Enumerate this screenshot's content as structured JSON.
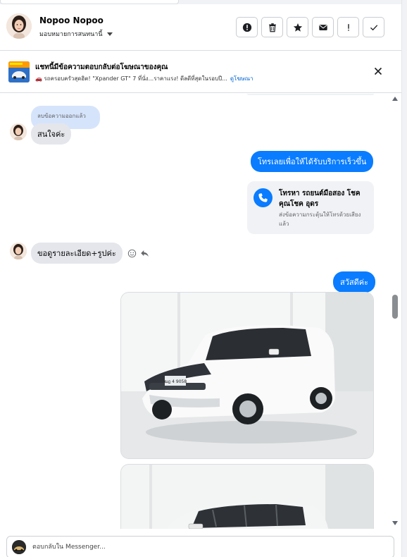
{
  "header": {
    "name": "Nopoo Nopoo",
    "assign_label": "มอบหมายการสนทนานี้",
    "actions": [
      "mark-spam-icon",
      "delete-icon",
      "star-icon",
      "mark-unread-icon",
      "follow-up-icon",
      "done-icon"
    ]
  },
  "banner": {
    "title": "แชทนี้มีข้อความตอบกลับต่อโฆษณาของคุณ",
    "subtitle": "🚗 รถครอบครัวสุดฮิต! \"Xpander GT\" 7 ที่นั่ง...ราคาแรง! ดีลดีที่สุดในรอบปี...",
    "link": "ดูโฆษณา"
  },
  "messages": {
    "unsent_label": "ลบข้อความออกแล้ว",
    "incoming_1": "สนใจค่ะ",
    "outgoing_1": "โทรเลยเพื่อให้ได้รับบริการเร็วขึ้น",
    "call_card": {
      "title": "โทรหา รถยนต์มือสอง โชคคุณโชค อุดร",
      "subtitle": "ส่งข้อความกระตุ้นให้โทรด้วยเสียงแล้ว"
    },
    "incoming_2": "ขอดูรายละเอียด+รูปค่ะ",
    "outgoing_2": "สวัสดีค่ะ",
    "plate_text": "ฒฎ 4 9058"
  },
  "composer": {
    "placeholder": "ตอบกลับใน Messenger..."
  },
  "colors": {
    "accent": "#0a7cff",
    "incoming_bubble": "#e4e6eb",
    "unsent_bubble": "#d6e4fb"
  }
}
